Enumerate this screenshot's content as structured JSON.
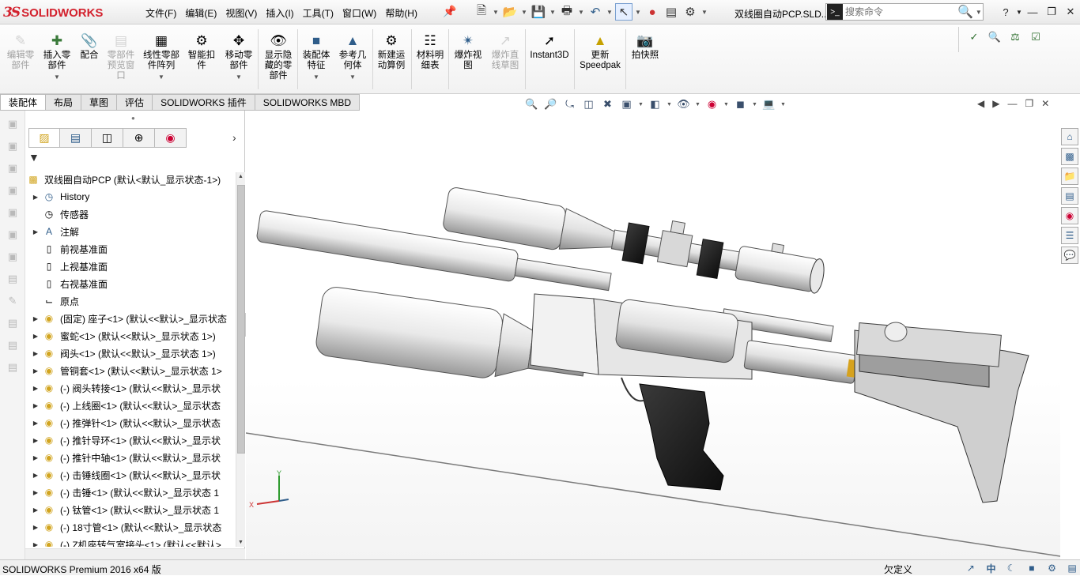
{
  "app": {
    "logo_text": "SOLIDWORKS",
    "document_title": "双线圈自动PCP.SLD...",
    "colors": {
      "brand_red": "#d3212d",
      "accent_blue": "#3a6fb7"
    }
  },
  "menu": [
    "文件(F)",
    "编辑(E)",
    "视图(V)",
    "插入(I)",
    "工具(T)",
    "窗口(W)",
    "帮助(H)"
  ],
  "search": {
    "placeholder": "搜索命令"
  },
  "quick_access_icons": [
    "new-icon",
    "open-icon",
    "save-icon",
    "print-icon",
    "undo-icon",
    "select-icon",
    "rebuild-icon",
    "file-properties-icon",
    "options-icon"
  ],
  "window_controls": [
    "help-icon",
    "minimize-icon",
    "restore-icon",
    "close-icon"
  ],
  "ribbon": [
    {
      "label": "编辑零\n部件",
      "disabled": true,
      "icon": "edit-component-icon"
    },
    {
      "label": "插入零\n部件",
      "disabled": false,
      "icon": "insert-component-icon",
      "dropdown": true
    },
    {
      "label": "配合",
      "disabled": false,
      "icon": "mate-icon"
    },
    {
      "label": "零部件\n预览窗\n口",
      "disabled": true,
      "icon": "preview-window-icon"
    },
    {
      "label": "线性零部\n件阵列",
      "disabled": false,
      "icon": "linear-pattern-icon",
      "dropdown": true
    },
    {
      "label": "智能扣\n件",
      "disabled": false,
      "icon": "smart-fastener-icon"
    },
    {
      "label": "移动零\n部件",
      "disabled": false,
      "icon": "move-component-icon",
      "dropdown": true
    },
    {
      "label": "显示隐\n藏的零\n部件",
      "disabled": false,
      "icon": "show-hidden-icon"
    },
    {
      "label": "装配体\n特征",
      "disabled": false,
      "icon": "assembly-feature-icon",
      "dropdown": true
    },
    {
      "label": "参考几\n何体",
      "disabled": false,
      "icon": "reference-geometry-icon",
      "dropdown": true
    },
    {
      "label": "新建运\n动算例",
      "disabled": false,
      "icon": "motion-study-icon"
    },
    {
      "label": "材料明\n细表",
      "disabled": false,
      "icon": "bom-icon"
    },
    {
      "label": "爆炸视\n图",
      "disabled": false,
      "icon": "exploded-view-icon"
    },
    {
      "label": "爆炸直\n线草图",
      "disabled": true,
      "icon": "explode-line-icon"
    },
    {
      "label": "Instant3D",
      "disabled": false,
      "icon": "instant3d-icon"
    },
    {
      "label": "更新\nSpeedpak",
      "disabled": false,
      "icon": "speedpak-icon"
    },
    {
      "label": "拍快照",
      "disabled": false,
      "icon": "snapshot-icon"
    }
  ],
  "tabs": [
    "装配体",
    "布局",
    "草图",
    "评估",
    "SOLIDWORKS 插件",
    "SOLIDWORKS MBD"
  ],
  "active_tab": "装配体",
  "tree": {
    "root": "双线圈自动PCP (默认<默认_显示状态-1>)",
    "items": [
      {
        "label": "History",
        "expandable": true,
        "icon": "history-icon"
      },
      {
        "label": "传感器",
        "expandable": false,
        "icon": "sensor-icon"
      },
      {
        "label": "注解",
        "expandable": true,
        "icon": "annotation-icon"
      },
      {
        "label": "前视基准面",
        "expandable": false,
        "icon": "plane-icon"
      },
      {
        "label": "上视基准面",
        "expandable": false,
        "icon": "plane-icon"
      },
      {
        "label": "右视基准面",
        "expandable": false,
        "icon": "plane-icon"
      },
      {
        "label": "原点",
        "expandable": false,
        "icon": "origin-icon"
      },
      {
        "label": "(固定) 座子<1> (默认<<默认>_显示状态",
        "expandable": true,
        "icon": "part-icon"
      },
      {
        "label": "蜜蛇<1> (默认<<默认>_显示状态 1>)",
        "expandable": true,
        "icon": "part-icon"
      },
      {
        "label": "阀头<1> (默认<<默认>_显示状态 1>)",
        "expandable": true,
        "icon": "part-icon"
      },
      {
        "label": "管铜套<1> (默认<<默认>_显示状态 1>",
        "expandable": true,
        "icon": "part-icon"
      },
      {
        "label": "(-) 阀头转接<1> (默认<<默认>_显示状",
        "expandable": true,
        "icon": "part-icon"
      },
      {
        "label": "(-) 上线圈<1> (默认<<默认>_显示状态",
        "expandable": true,
        "icon": "part-icon"
      },
      {
        "label": "(-) 推弹针<1> (默认<<默认>_显示状态",
        "expandable": true,
        "icon": "part-icon"
      },
      {
        "label": "(-) 推针导环<1> (默认<<默认>_显示状",
        "expandable": true,
        "icon": "part-icon"
      },
      {
        "label": "(-) 推针中轴<1> (默认<<默认>_显示状",
        "expandable": true,
        "icon": "part-icon"
      },
      {
        "label": "(-) 击锤线圈<1> (默认<<默认>_显示状",
        "expandable": true,
        "icon": "part-icon"
      },
      {
        "label": "(-) 击锤<1> (默认<<默认>_显示状态 1",
        "expandable": true,
        "icon": "part-icon"
      },
      {
        "label": "(-) 钛管<1> (默认<<默认>_显示状态 1",
        "expandable": true,
        "icon": "part-icon"
      },
      {
        "label": "(-) 18寸管<1> (默认<<默认>_显示状态",
        "expandable": true,
        "icon": "part-icon"
      },
      {
        "label": "(-) Z机座转气室接头<1> (默认<<默认>",
        "expandable": true,
        "icon": "part-icon"
      }
    ]
  },
  "view_toolbar_icons": [
    "zoom-to-fit-icon",
    "zoom-area-icon",
    "previous-view-icon",
    "section-view-icon",
    "dynamic-annotation-icon",
    "view-orientation-icon",
    "display-style-icon",
    "hide-show-icon",
    "edit-appearance-icon",
    "apply-scene-icon",
    "view-settings-icon"
  ],
  "right_tabs": [
    "home-icon",
    "3d-content-icon",
    "file-explorer-icon",
    "view-palette-icon",
    "appearances-icon",
    "custom-properties-icon",
    "forum-icon"
  ],
  "triad": {
    "x": "X",
    "y": "Y"
  },
  "status": {
    "product": "SOLIDWORKS Premium 2016 x64 版",
    "state": "欠定义",
    "ime": "中"
  }
}
